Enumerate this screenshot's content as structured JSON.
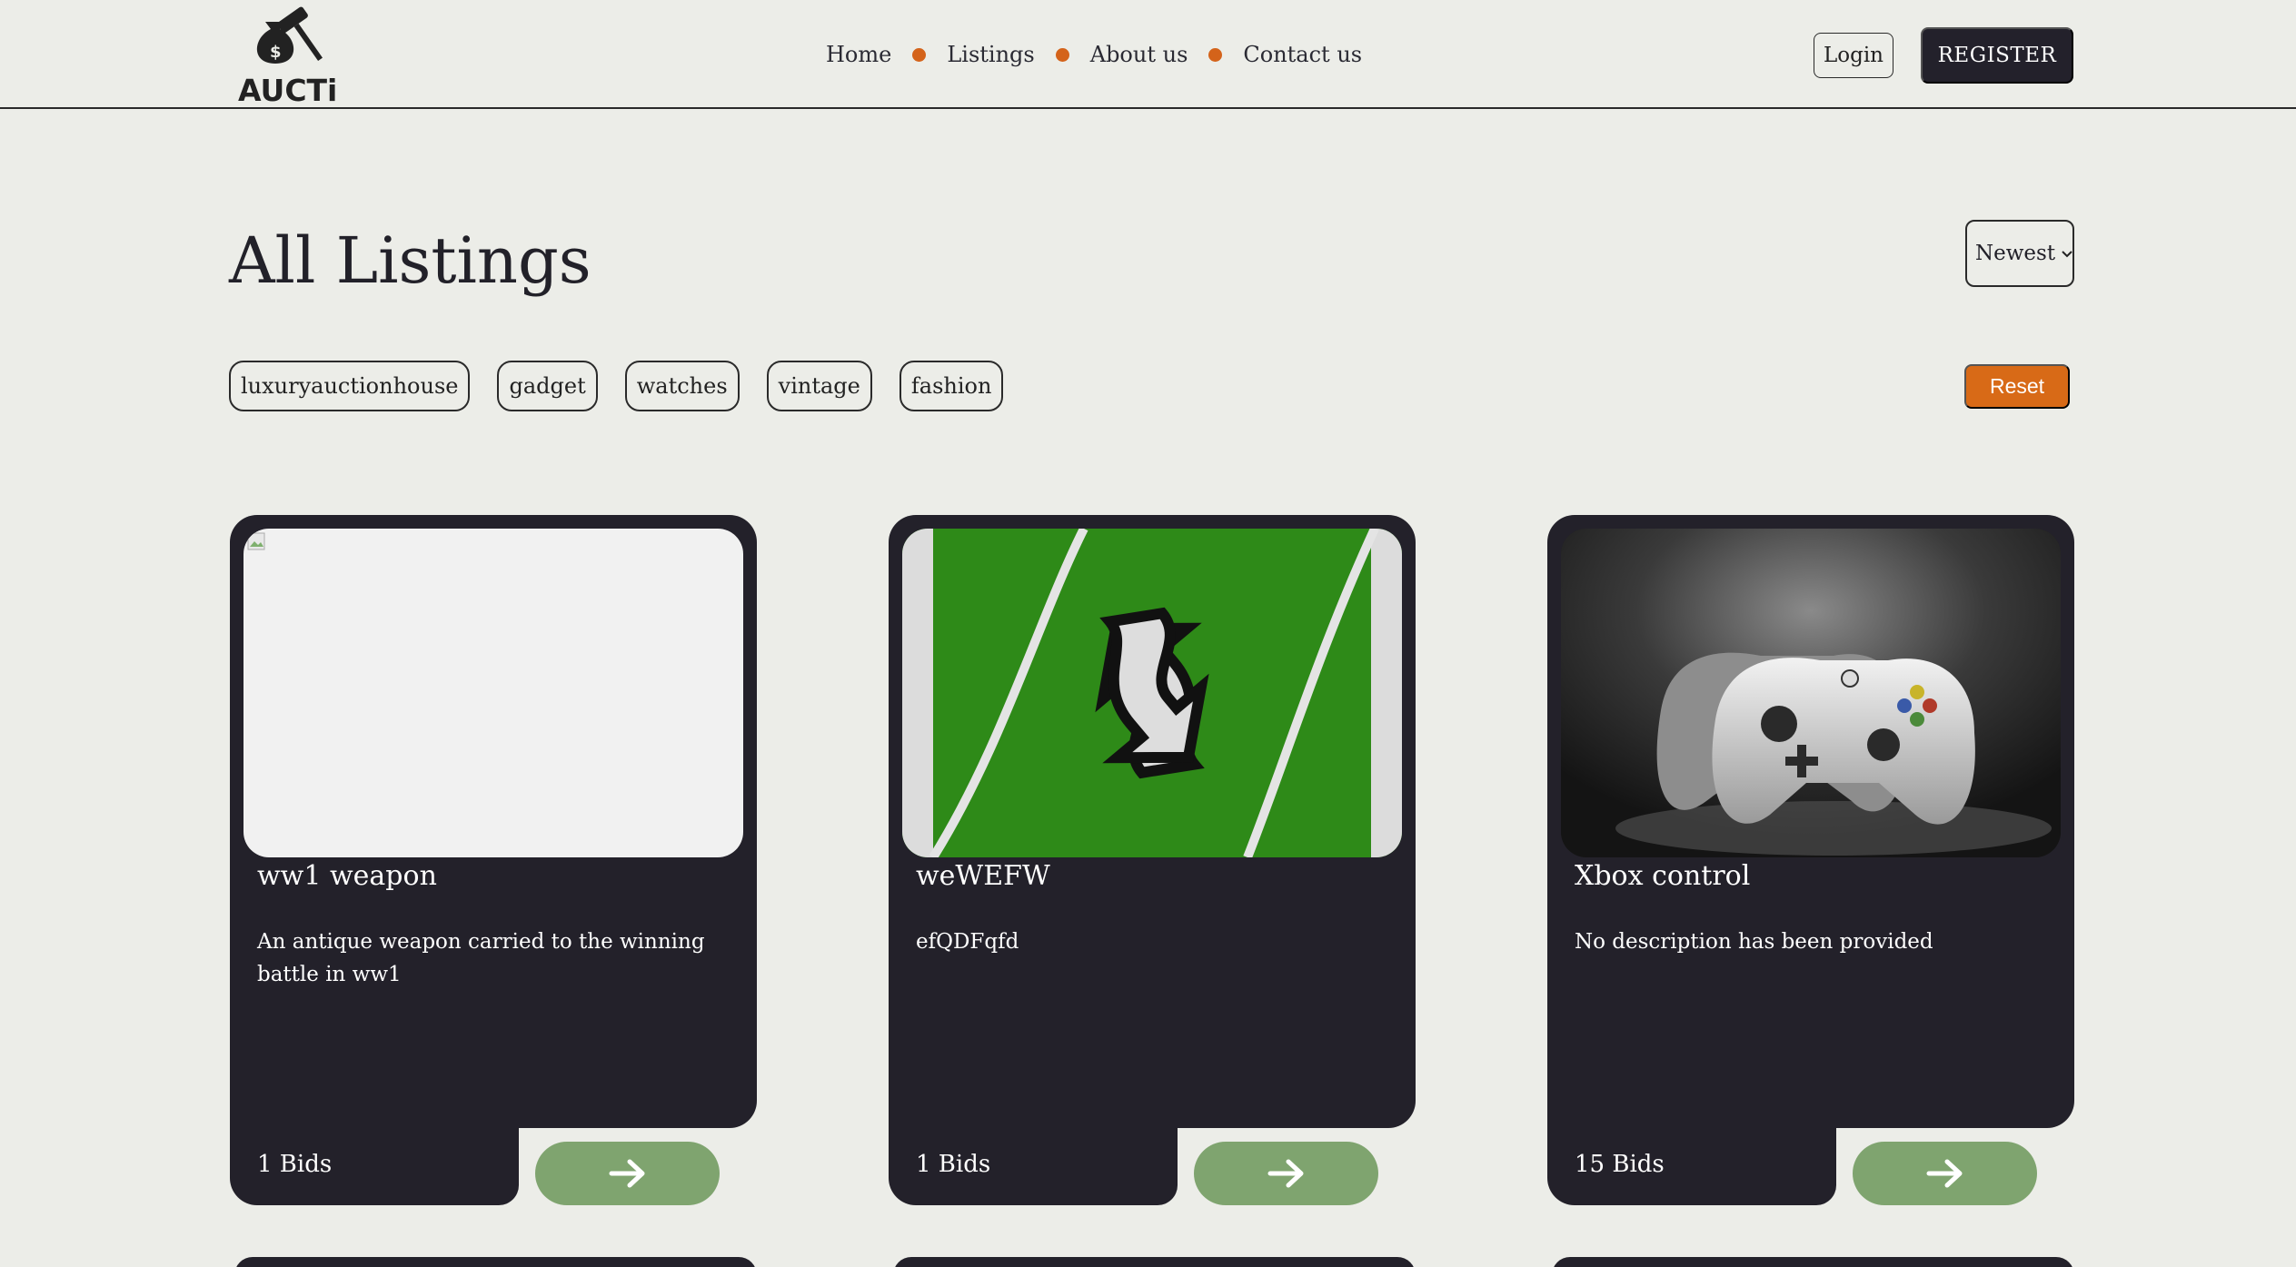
{
  "header": {
    "logo_text": "AUCTi",
    "nav": [
      {
        "label": "Home"
      },
      {
        "label": "Listings"
      },
      {
        "label": "About us"
      },
      {
        "label": "Contact us"
      }
    ],
    "login_label": "Login",
    "register_label": "REGISTER"
  },
  "main": {
    "title": "All Listings",
    "sort": {
      "selected": "Newest"
    },
    "tags": [
      "luxuryauctionhouse",
      "gadget",
      "watches",
      "vintage",
      "fashion"
    ],
    "reset_label": "Reset"
  },
  "listings": [
    {
      "title": "ww1 weapon",
      "description": "An antique weapon carried to the winning battle in ww1",
      "bids": "1 Bids",
      "image": "broken-image"
    },
    {
      "title": "weWEFW",
      "description": "efQDFqfd",
      "bids": "1 Bids",
      "image": "uno-reverse-card"
    },
    {
      "title": "Xbox control",
      "description": "No description has been provided",
      "bids": "15 Bids",
      "image": "xbox-controller"
    }
  ],
  "colors": {
    "background": "#ecede8",
    "accent": "#d86a17",
    "card": "#23212a",
    "button_green": "#7fa46f",
    "dark_button": "#23212b"
  }
}
